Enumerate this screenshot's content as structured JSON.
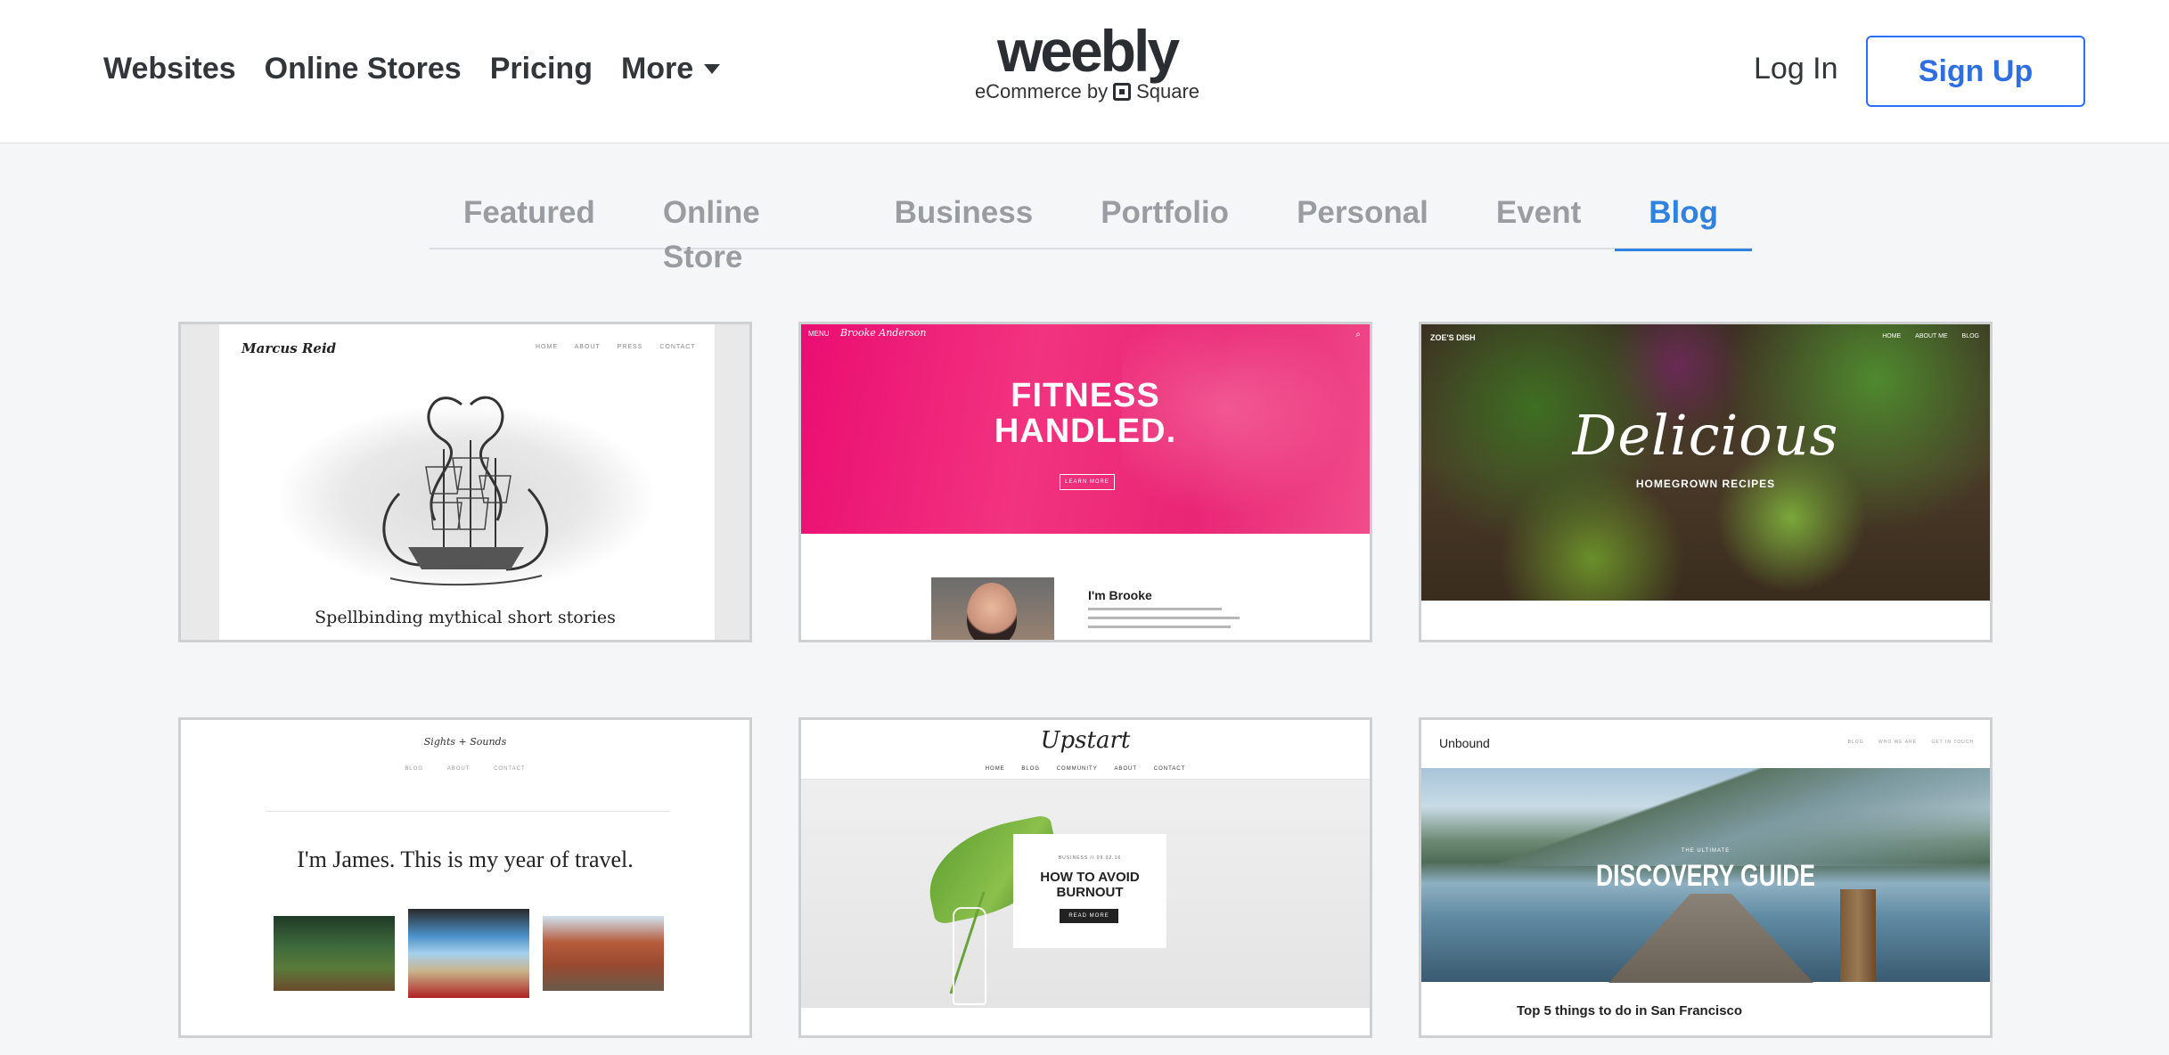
{
  "header": {
    "nav": [
      "Websites",
      "Online Stores",
      "Pricing"
    ],
    "more_label": "More",
    "logo": "weebly",
    "logo_sub_prefix": "eCommerce by",
    "logo_sub_brand": "Square",
    "login_label": "Log In",
    "signup_label": "Sign Up",
    "accent_color": "#2f82de"
  },
  "tabs": {
    "items": [
      "Featured",
      "Online Store",
      "Business",
      "Portfolio",
      "Personal",
      "Event",
      "Blog"
    ],
    "active": "Blog"
  },
  "cards": [
    {
      "site_name": "Marcus Reid",
      "menu": [
        "HOME",
        "ABOUT",
        "PRESS",
        "CONTACT"
      ],
      "caption": "Spellbinding mythical short stories"
    },
    {
      "menu_label": "MENU",
      "site_name": "Brooke Anderson",
      "title_line1": "FITNESS",
      "title_line2": "HANDLED.",
      "button": "LEARN MORE",
      "intro_heading": "I'm Brooke"
    },
    {
      "site_name": "ZOE'S DISH",
      "menu": [
        "HOME",
        "ABOUT ME",
        "BLOG"
      ],
      "title": "Delicious",
      "subtitle": "HOMEGROWN RECIPES"
    },
    {
      "site_name": "Sights + Sounds",
      "menu": [
        "BLOG",
        "ABOUT",
        "CONTACT"
      ],
      "headline": "I'm James. This is my year of travel."
    },
    {
      "site_name": "Upstart",
      "menu": [
        "HOME",
        "BLOG",
        "COMMUNITY",
        "ABOUT",
        "CONTACT"
      ],
      "post_meta": "BUSINESS // 09.02.16",
      "post_title_line1": "HOW TO AVOID",
      "post_title_line2": "BURNOUT",
      "button": "READ MORE"
    },
    {
      "site_name": "Unbound",
      "menu": [
        "BLOG",
        "WHO WE ARE",
        "GET IN TOUCH"
      ],
      "kicker": "THE ULTIMATE",
      "title": "DISCOVERY GUIDE",
      "post_title": "Top 5 things to do in San Francisco"
    }
  ]
}
